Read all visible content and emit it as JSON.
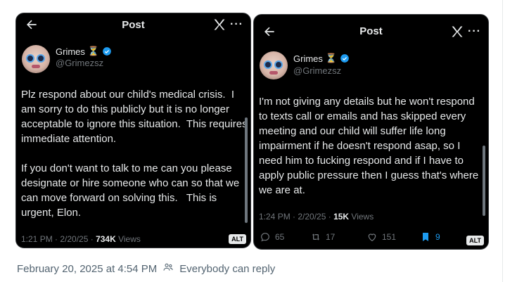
{
  "cards": [
    {
      "header_title": "Post",
      "author": {
        "name": "Grimes",
        "handle": "@Grimezsz"
      },
      "body": "Plz respond about our child's medical crisis.  I am sorry to do this publicly but it is no longer acceptable to ignore this situation.  This requires immediate attention.\n\nIf you don't want to talk to me can you please designate or hire someone who can so that we can move forward on solving this.   This is urgent, Elon.",
      "meta_time": "1:21 PM · 2/20/25 · ",
      "meta_views_count": "734K",
      "meta_views_label": " Views",
      "alt_label": "ALT"
    },
    {
      "header_title": "Post",
      "author": {
        "name": "Grimes",
        "handle": "@Grimezsz"
      },
      "body": "I'm not giving any details but he won't respond to texts call or emails and has skipped every meeting and our child will suffer life long impairment if he doesn't respond asap, so I need him to fucking respond and if I have to apply public pressure then I guess that's where we are at.",
      "meta_time": "1:24 PM · 2/20/25 · ",
      "meta_views_count": "15K",
      "meta_views_label": " Views",
      "actions": {
        "replies": "65",
        "reposts": "17",
        "likes": "151",
        "bookmarks": "9"
      },
      "alt_label": "ALT"
    }
  ],
  "footer": {
    "timestamp": "February 20, 2025 at 4:54 PM",
    "reply_setting": "Everybody can reply"
  },
  "colors": {
    "background": "#000000",
    "text": "#e7e9ea",
    "muted": "#71767b",
    "accent": "#1d9bf0"
  },
  "icons": [
    "back-arrow-icon",
    "x-logo-icon",
    "more-icon",
    "hourglass-icon",
    "verified-badge-icon",
    "reply-icon",
    "repost-icon",
    "like-icon",
    "bookmark-icon",
    "people-icon"
  ]
}
